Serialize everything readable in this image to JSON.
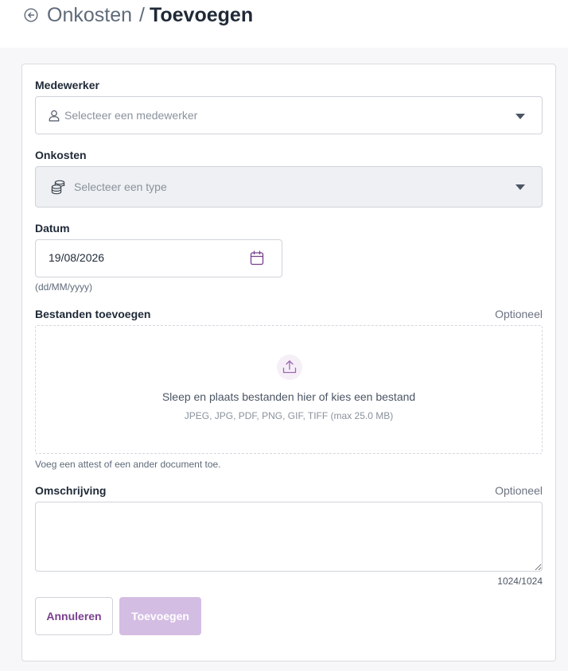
{
  "header": {
    "back_icon": "arrow-left-circle-icon",
    "parent": "Onkosten",
    "separator": "/",
    "current": "Toevoegen"
  },
  "form": {
    "employee": {
      "label": "Medewerker",
      "placeholder": "Selecteer een medewerker",
      "icon": "user-icon"
    },
    "expense": {
      "label": "Onkosten",
      "placeholder": "Selecteer een type",
      "icon": "coins-icon"
    },
    "date": {
      "label": "Datum",
      "value": "19/08/2026",
      "format_hint": "(dd/MM/yyyy)",
      "icon": "calendar-icon"
    },
    "files": {
      "label": "Bestanden toevoegen",
      "optional": "Optioneel",
      "dropzone_text": "Sleep en plaats bestanden hier of kies een bestand",
      "allowed_types": "JPEG, JPG, PDF, PNG, GIF, TIFF (max 25.0 MB)",
      "helper": "Voeg een attest of een ander document toe.",
      "icon": "upload-icon"
    },
    "description": {
      "label": "Omschrijving",
      "optional": "Optioneel",
      "value": "",
      "counter": "1024/1024"
    },
    "actions": {
      "cancel": "Annuleren",
      "submit": "Toevoegen"
    }
  },
  "colors": {
    "accent": "#7a3f8f",
    "accent_disabled": "#d4bde3",
    "text": "#1f2937",
    "muted": "#6b7280",
    "border": "#cfd3d9"
  }
}
